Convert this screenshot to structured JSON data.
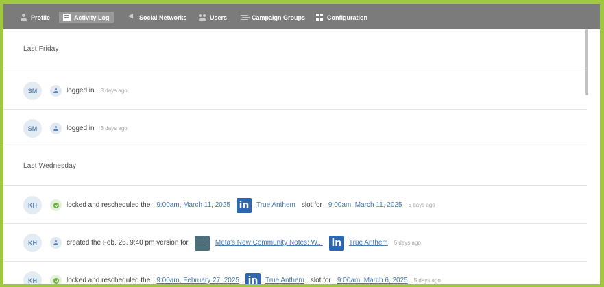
{
  "tabs": [
    {
      "label": "Profile",
      "icon": "person-icon"
    },
    {
      "label": "Activity Log",
      "icon": "activity-log-icon"
    },
    {
      "label": "Social Networks",
      "icon": "share-icon"
    },
    {
      "label": "Users",
      "icon": "users-icon"
    },
    {
      "label": "Campaign Groups",
      "icon": "campaign-groups-icon"
    },
    {
      "label": "Configuration",
      "icon": "configuration-icon"
    }
  ],
  "activity": {
    "sections": [
      {
        "heading": "Last Friday"
      },
      {
        "heading": "Last Wednesday"
      }
    ],
    "entries": [
      {
        "initials": "SM",
        "action": "logged in",
        "time": "3 days ago"
      },
      {
        "initials": "SM",
        "action": "logged in",
        "time": "3 days ago"
      },
      {
        "initials": "KH",
        "action": "locked and rescheduled the",
        "from_slot": "9:00am, March 11, 2025",
        "network": "True Anthem",
        "mid": "slot for",
        "to_slot": "9:00am, March 11, 2025",
        "time": "5 days ago"
      },
      {
        "initials": "KH",
        "action": "created the Feb. 26, 9:40 pm version for",
        "post": "Meta's New Community Notes: W...",
        "network": "True Anthem",
        "time": "5 days ago"
      },
      {
        "initials": "KH",
        "action": "locked and rescheduled the",
        "from_slot": "9:00am, February 27, 2025",
        "network": "True Anthem",
        "mid": "slot for",
        "to_slot": "9:00am, March 6, 2025",
        "time": "5 days ago"
      }
    ]
  },
  "linkedin_glyph": "in",
  "colors": {
    "accent_green": "#9fc83f",
    "topbar": "#7b7b7b",
    "link": "#4a78b5",
    "linkedin": "#2e67b1"
  }
}
